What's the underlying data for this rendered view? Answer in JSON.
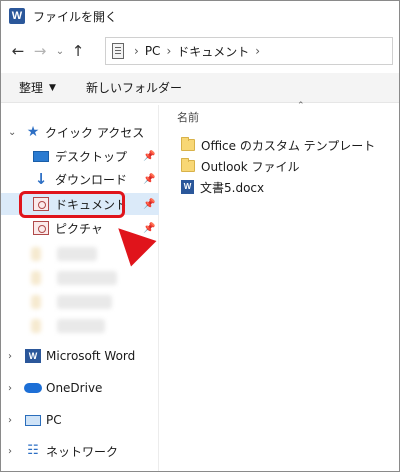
{
  "window": {
    "title": "ファイルを開く",
    "app_icon_letter": "W"
  },
  "navigation": {
    "back_icon": "arrow-left",
    "forward_icon": "arrow-right",
    "recent_icon": "chevron-down",
    "up_icon": "arrow-up",
    "breadcrumb": [
      "PC",
      "ドキュメント"
    ]
  },
  "toolbar": {
    "organize_label": "整理",
    "new_folder_label": "新しいフォルダー"
  },
  "sidebar": {
    "quick_access": "クイック アクセス",
    "items": [
      {
        "label": "デスクトップ",
        "pinned": true
      },
      {
        "label": "ダウンロード",
        "pinned": true
      },
      {
        "label": "ドキュメント",
        "pinned": true,
        "selected": true
      },
      {
        "label": "ピクチャ",
        "pinned": true
      }
    ],
    "roots": [
      {
        "label": "Microsoft Word"
      },
      {
        "label": "OneDrive"
      },
      {
        "label": "PC"
      },
      {
        "label": "ネットワーク"
      }
    ]
  },
  "files": {
    "column_name": "名前",
    "items": [
      {
        "name": "Office のカスタム テンプレート",
        "type": "folder"
      },
      {
        "name": "Outlook ファイル",
        "type": "folder"
      },
      {
        "name": "文書5.docx",
        "type": "docx"
      }
    ]
  },
  "colors": {
    "highlight": "#e0141b",
    "selection": "#dbeaf9",
    "accent": "#2d6fc4"
  }
}
